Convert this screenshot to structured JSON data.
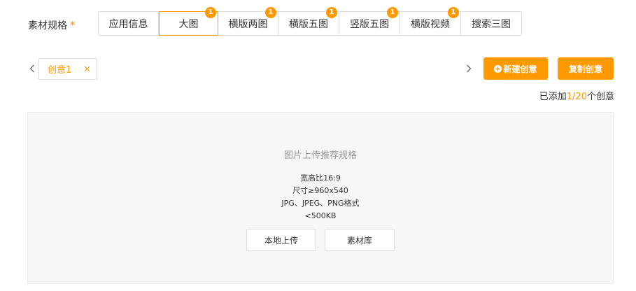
{
  "spec": {
    "label": "素材规格",
    "required_mark": "*",
    "tabs": [
      {
        "label": "应用信息",
        "badge": null,
        "active": false
      },
      {
        "label": "大图",
        "badge": "1",
        "active": true
      },
      {
        "label": "横版两图",
        "badge": "1",
        "active": false
      },
      {
        "label": "横版五图",
        "badge": "1",
        "active": false
      },
      {
        "label": "竖版五图",
        "badge": "1",
        "active": false
      },
      {
        "label": "横版视频",
        "badge": "1",
        "active": false
      },
      {
        "label": "搜索三图",
        "badge": null,
        "active": false
      }
    ]
  },
  "creatives": {
    "tag_label": "创意1",
    "new_button": "新建创意",
    "copy_button": "复制创意",
    "count_prefix": "已添加",
    "count_value": "1/20",
    "count_suffix": "个创意"
  },
  "upload": {
    "title": "图片上传推荐规格",
    "lines": [
      "宽高比16:9",
      "尺寸≥960x540",
      "JPG、JPEG、PNG格式",
      "<500KB"
    ],
    "local_button": "本地上传",
    "library_button": "素材库"
  },
  "colors": {
    "accent": "#ff9900",
    "border": "#dcdcdc",
    "panel_bg": "#f7f7f7"
  },
  "icons": {
    "prev": "chevron-left-icon",
    "next": "chevron-right-icon",
    "close": "close-icon",
    "plus": "plus-circle-icon"
  }
}
